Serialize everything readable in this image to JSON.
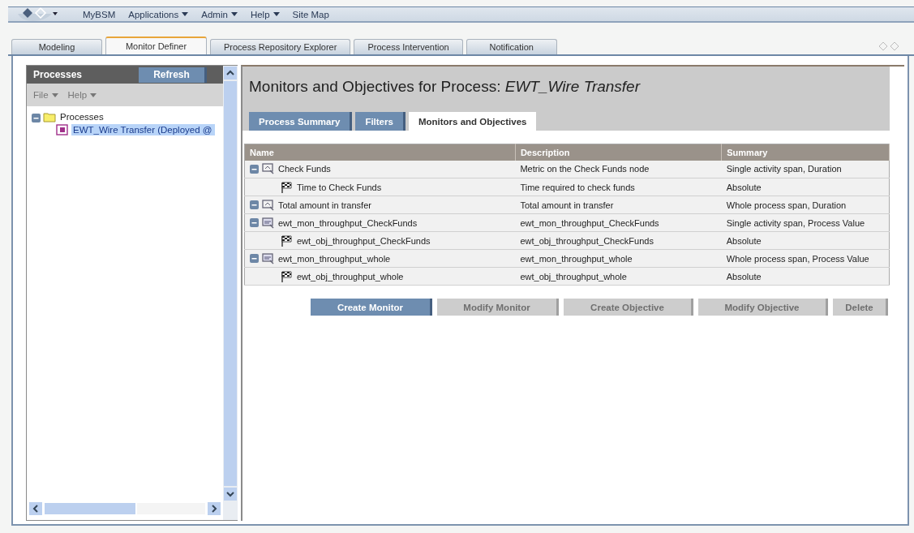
{
  "menu": [
    {
      "label": "MyBSM",
      "dropdown": false
    },
    {
      "label": "Applications",
      "dropdown": true
    },
    {
      "label": "Admin",
      "dropdown": true
    },
    {
      "label": "Help",
      "dropdown": true
    },
    {
      "label": "Site Map",
      "dropdown": false
    }
  ],
  "tabs": [
    {
      "label": "Modeling",
      "selected": false
    },
    {
      "label": "Monitor Definer",
      "selected": true
    },
    {
      "label": "Process Repository Explorer",
      "selected": false
    },
    {
      "label": "Process Intervention",
      "selected": false
    },
    {
      "label": "Notification",
      "selected": false
    }
  ],
  "sidebar": {
    "title": "Processes",
    "refresh": "Refresh",
    "menus": [
      "File",
      "Help"
    ],
    "tree": [
      {
        "label": "Processes",
        "expanded": true,
        "selected": false,
        "children": [
          {
            "label": "EWT_Wire Transfer (Deployed @",
            "selected": true
          }
        ]
      }
    ]
  },
  "main": {
    "title": "Monitors and Objectives for Process: *EWT_Wire Transfer*",
    "subtabs": [
      {
        "label": "Process Summary",
        "selected": false
      },
      {
        "label": "Filters",
        "selected": false
      },
      {
        "label": "Monitors and Objectives",
        "selected": true
      }
    ],
    "table": {
      "columns": [
        "Name",
        "Description",
        "Summary"
      ],
      "rows": [
        {
          "kind": "monitor",
          "expanded": true,
          "name": "Check Funds",
          "description": "Metric on the Check Funds node",
          "summary": "Single activity span, Duration"
        },
        {
          "kind": "objective",
          "name": "Time to Check Funds",
          "description": "Time required to check funds",
          "summary": "Absolute"
        },
        {
          "kind": "monitor",
          "expanded": true,
          "name": "Total amount in transfer",
          "description": "Total amount in transfer",
          "summary": "Whole process span, Duration"
        },
        {
          "kind": "value-monitor",
          "expanded": true,
          "name": "ewt_mon_throughput_CheckFunds",
          "description": "ewt_mon_throughput_CheckFunds",
          "summary": "Single activity span, Process Value"
        },
        {
          "kind": "objective",
          "name": "ewt_obj_throughput_CheckFunds",
          "description": "ewt_obj_throughput_CheckFunds",
          "summary": "Absolute"
        },
        {
          "kind": "value-monitor",
          "expanded": true,
          "name": "ewt_mon_throughput_whole",
          "description": "ewt_mon_throughput_whole",
          "summary": "Whole process span, Process Value"
        },
        {
          "kind": "objective",
          "name": "ewt_obj_throughput_whole",
          "description": "ewt_obj_throughput_whole",
          "summary": "Absolute"
        }
      ]
    },
    "buttons": [
      {
        "label": "Create Monitor",
        "disabled": false
      },
      {
        "label": "Modify Monitor",
        "disabled": true
      },
      {
        "label": "Create Objective",
        "disabled": true
      },
      {
        "label": "Modify Objective",
        "disabled": true
      },
      {
        "label": "Delete",
        "disabled": true
      }
    ]
  }
}
